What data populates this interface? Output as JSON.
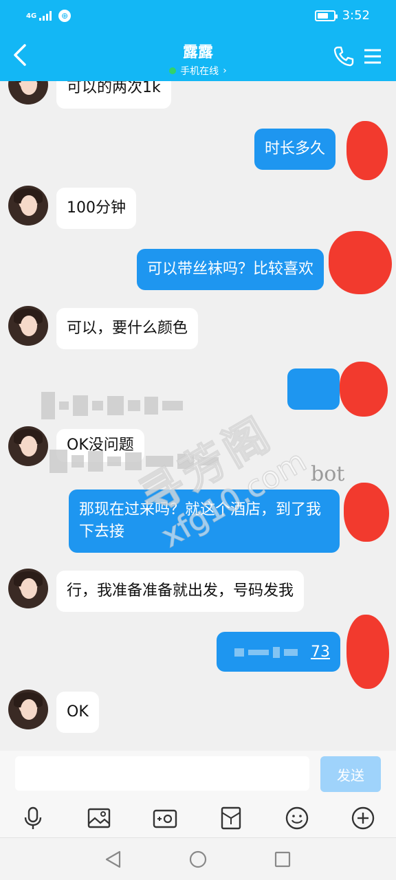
{
  "status_bar": {
    "network": "4G",
    "time": "3:52",
    "battery_level": 0.7
  },
  "header": {
    "title": "露露",
    "subtitle": "手机在线",
    "subtitle_chevron": "›",
    "accent": "#13b7f5",
    "icons": [
      "back-arrow-icon",
      "phone-icon",
      "menu-icon"
    ]
  },
  "messages": [
    {
      "side": "in",
      "text": "可以的两次1k"
    },
    {
      "side": "out",
      "text": "时长多久"
    },
    {
      "side": "in",
      "text": "100分钟"
    },
    {
      "side": "out",
      "text": "可以带丝袜吗？比较喜欢"
    },
    {
      "side": "in",
      "text": "可以，要什么颜色"
    },
    {
      "side": "out",
      "text": ""
    },
    {
      "side": "in",
      "text": "OK没问题"
    },
    {
      "side": "out",
      "text": "那现在过来吗？就这个酒店，到了我下去接"
    },
    {
      "side": "in",
      "text": "行，我准备准备就出发，号码发我"
    },
    {
      "side": "out",
      "text": "73"
    },
    {
      "side": "in",
      "text": "OK"
    }
  ],
  "watermark": {
    "main": "寻芳阁",
    "domain": "xfg10.com",
    "extra": "bot"
  },
  "input": {
    "placeholder": "",
    "send_label": "发送",
    "send_color": "#9fd3fb"
  },
  "toolbar": {
    "icons": [
      "microphone-icon",
      "image-icon",
      "camera-icon",
      "red-packet-icon",
      "emoji-icon",
      "plus-icon"
    ]
  },
  "nav": {
    "icons": [
      "nav-back-icon",
      "nav-home-icon",
      "nav-recent-icon"
    ]
  }
}
